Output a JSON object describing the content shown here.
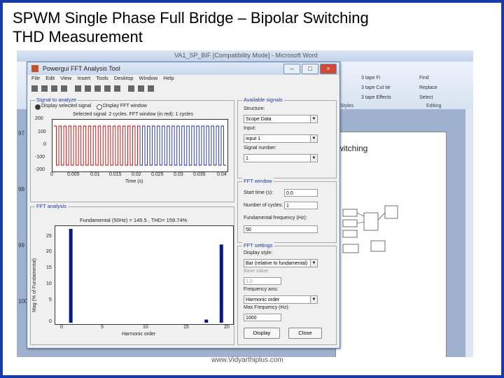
{
  "slide": {
    "title_line1": "SPWM Single Phase Full Bridge – Bipolar Switching",
    "title_line2": "THD Measurement",
    "footer": "www.Vidyarthiplus.com"
  },
  "word": {
    "title": "VA1_SP_BIF [Compatibility Mode] - Microsoft Word",
    "ribbon": {
      "styles": [
        "3 tape Fi",
        "3 tape Cut tie",
        "3 tape Effects"
      ],
      "editing": [
        "Find",
        "Replace",
        "Select"
      ],
      "group_styles": "Styles",
      "group_editing": "Editing"
    },
    "page_heading": "witching",
    "ruler_numbers": [
      "97",
      "98",
      "99",
      "100"
    ]
  },
  "fft": {
    "window_title": "Powergui FFT Analysis Tool",
    "menu": [
      "File",
      "Edit",
      "View",
      "Insert",
      "Tools",
      "Desktop",
      "Window",
      "Help"
    ],
    "signal_group": "Signal to analyze",
    "radio_selected": "Display selected signal",
    "radio_other": "Display FFT window",
    "signal_plot_title": "Selected signal: 2 cycles. FFT window (in red): 1 cycles",
    "signal_xlabel": "Time (s)",
    "signal_yticks": [
      "200",
      "100",
      "0",
      "-100",
      "-200"
    ],
    "signal_xticks": [
      "0",
      "0.005",
      "0.01",
      "0.015",
      "0.02",
      "0.025",
      "0.03",
      "0.035",
      "0.04"
    ],
    "analysis_group": "FFT analysis",
    "analysis_title": "Fundamental (50Hz) = 145.5 , THD= 159.74%",
    "analysis_ylabel": "Mag (% of Fundamental)",
    "analysis_xlabel": "Harmonic order",
    "analysis_yticks": [
      "25",
      "20",
      "15",
      "10",
      "5",
      "0"
    ],
    "analysis_xticks": [
      "0",
      "5",
      "10",
      "15",
      "20"
    ],
    "available_group": "Available signals",
    "structure_label": "Structure:",
    "structure_value": "Scope Data",
    "input_label": "Input:",
    "input_value": "input 1",
    "signal_number_label": "Signal number:",
    "signal_number_value": "1",
    "fftwindow_group": "FFT window",
    "start_time_label": "Start time (s):",
    "start_time_value": "0.0",
    "cycles_label": "Number of cycles:",
    "cycles_value": "1",
    "fund_freq_label": "Fundamental frequency (Hz):",
    "fund_freq_value": "50",
    "settings_group": "FFT settings",
    "display_style_label": "Display style:",
    "display_style_value": "Bar (relative to fundamental)",
    "base_value_label": "Base value:",
    "base_value_value": "1.0",
    "freq_axis_label": "Frequency axis:",
    "freq_axis_value": "Harmonic order",
    "max_freq_label": "Max Frequency (Hz):",
    "max_freq_value": "1000",
    "display_button": "Display",
    "close_button": "Close"
  },
  "chart_data": {
    "type": "bar",
    "title": "Fundamental (50Hz) = 145.5 , THD= 159.74%",
    "xlabel": "Harmonic order",
    "ylabel": "Mag (% of Fundamental)",
    "x": [
      1,
      19,
      21
    ],
    "values": [
      100,
      1,
      25
    ],
    "ylim": [
      0,
      30
    ],
    "xlim": [
      0,
      20
    ]
  },
  "colors": {
    "frame": "#1a3aa8",
    "bar": "#0a1a80",
    "signal_red": "#cc0000",
    "signal_blue": "#1a2aa0"
  }
}
